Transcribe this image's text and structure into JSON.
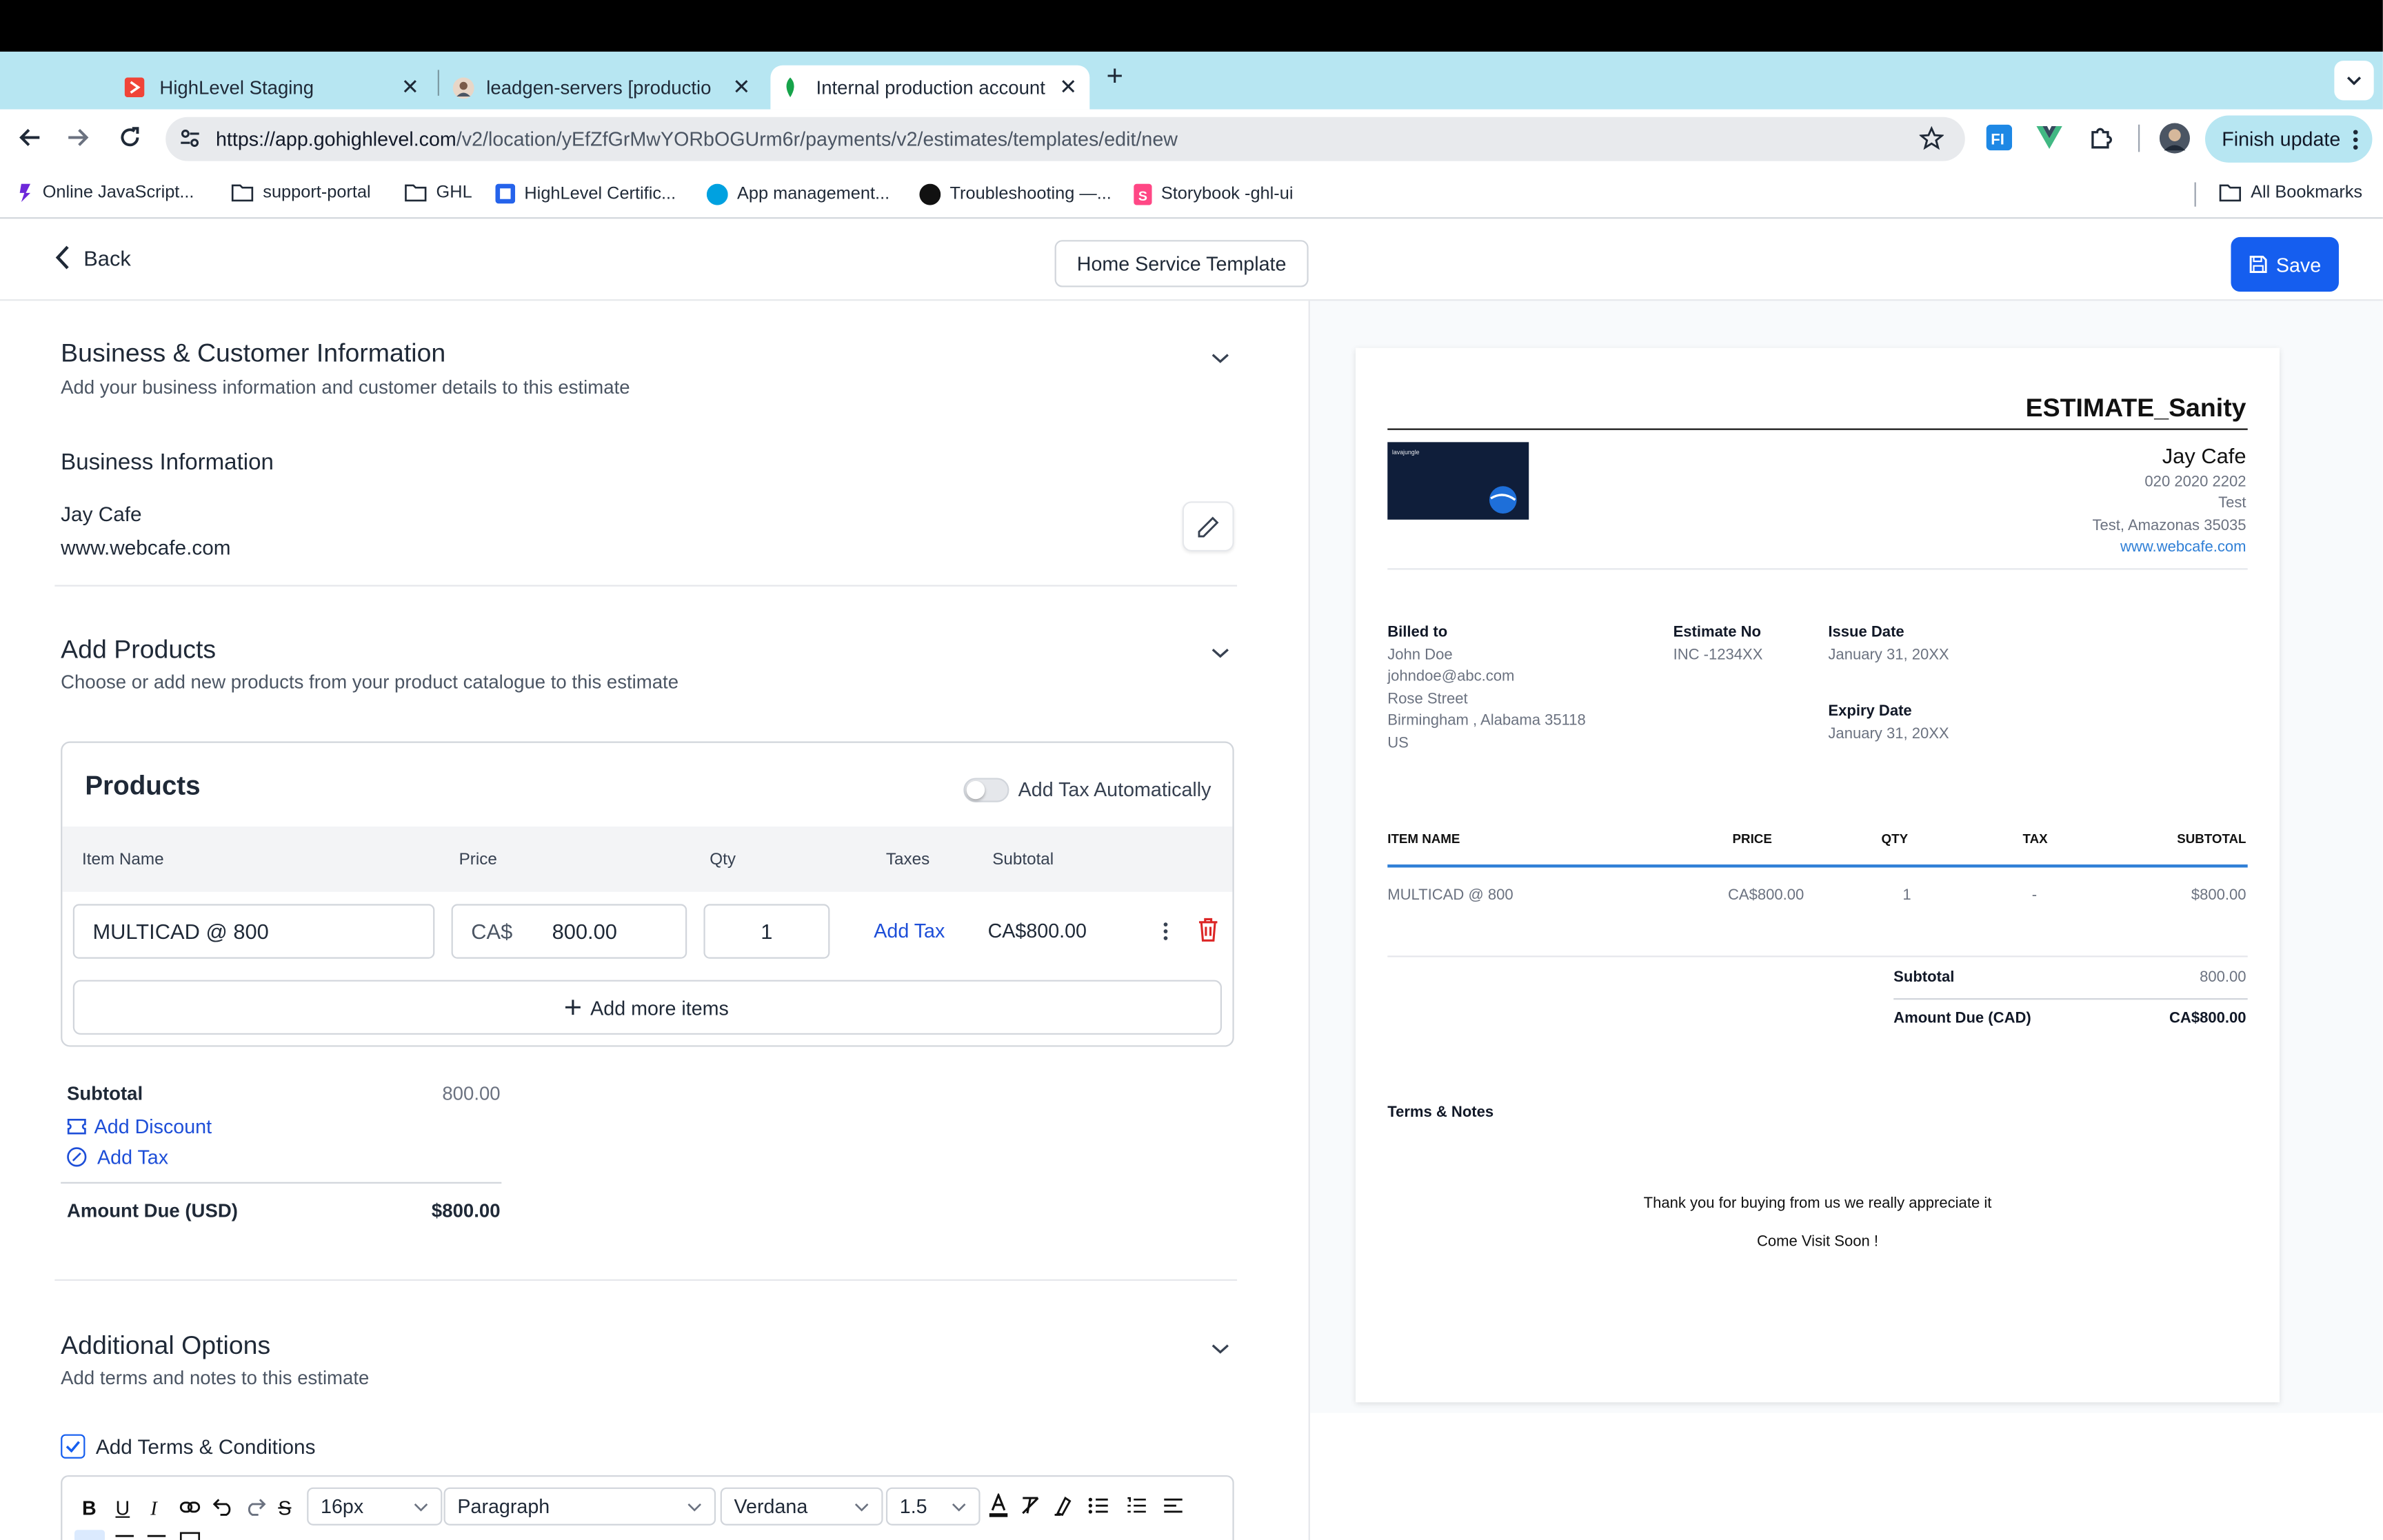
{
  "browser": {
    "tabs": [
      {
        "title": "HighLevel Staging"
      },
      {
        "title": "leadgen-servers [production"
      },
      {
        "title": "Internal production account"
      }
    ],
    "url_host": "https://app.gohighlevel.com",
    "url_path": "/v2/location/yEfZfGrMwYORbOGUrm6r/payments/v2/estimates/templates/edit/new",
    "finish_update_label": "Finish update",
    "bookmarks": [
      "Online JavaScript...",
      "support-portal",
      "GHL",
      "HighLevel Certific...",
      "App management...",
      "Troubleshooting —...",
      "Storybook -ghl-ui"
    ],
    "all_bookmarks_label": "All Bookmarks"
  },
  "header": {
    "back_label": "Back",
    "template_name": "Home Service Template",
    "save_label": "Save"
  },
  "business_section": {
    "title": "Business & Customer Information",
    "subtitle": "Add your business information and customer details to this estimate",
    "business_heading": "Business Information",
    "business_name": "Jay Cafe",
    "business_website": "www.webcafe.com"
  },
  "products_section": {
    "title": "Add Products",
    "subtitle": "Choose or add new products from your product catalogue to this estimate",
    "card_title": "Products",
    "tax_toggle_label": "Add Tax Automatically",
    "tax_toggle_on": false,
    "columns": {
      "item_name": "Item Name",
      "price": "Price",
      "qty": "Qty",
      "taxes": "Taxes",
      "subtotal": "Subtotal"
    },
    "row": {
      "item_name": "MULTICAD @ 800",
      "currency": "CA$",
      "price": "800.00",
      "qty": "1",
      "add_tax_label": "Add Tax",
      "subtotal": "CA$800.00"
    },
    "add_more_label": "Add more items",
    "summary": {
      "subtotal_label": "Subtotal",
      "subtotal_value": "800.00",
      "add_discount_label": "Add Discount",
      "add_tax_label": "Add Tax",
      "amount_due_label": "Amount Due (USD)",
      "amount_due_value": "$800.00"
    }
  },
  "additional_section": {
    "title": "Additional Options",
    "subtitle": "Add terms and notes to this estimate",
    "terms_checkbox_label": "Add Terms & Conditions",
    "terms_checked": true,
    "editor": {
      "font_size": "16px",
      "block": "Paragraph",
      "font": "Verdana",
      "line_height": "1.5"
    }
  },
  "preview": {
    "title": "ESTIMATE_Sanity",
    "logo_text": "lavajungle",
    "business": {
      "name": "Jay Cafe",
      "phone": "020 2020 2202",
      "line1": "Test",
      "line2": "Test, Amazonas 35035",
      "website": "www.webcafe.com"
    },
    "billed_to_label": "Billed to",
    "billed_to": [
      "John Doe",
      "johndoe@abc.com",
      "Rose Street",
      "Birmingham , Alabama 35118",
      "US"
    ],
    "estimate_no_label": "Estimate No",
    "estimate_no": "INC -1234XX",
    "issue_date_label": "Issue Date",
    "issue_date": "January 31, 20XX",
    "expiry_date_label": "Expiry Date",
    "expiry_date": "January 31, 20XX",
    "table_headers": {
      "item_name": "ITEM NAME",
      "price": "PRICE",
      "qty": "QTY",
      "tax": "TAX",
      "subtotal": "SUBTOTAL"
    },
    "row": {
      "item_name": "MULTICAD @ 800",
      "price": "CA$800.00",
      "qty": "1",
      "tax": "-",
      "subtotal": "$800.00"
    },
    "subtotal_label": "Subtotal",
    "subtotal_value": "800.00",
    "amount_due_label": "Amount Due (CAD)",
    "amount_due_value": "CA$800.00",
    "terms_label": "Terms & Notes",
    "note_line1": "Thank you for buying from us we really appreciate it",
    "note_line2": "Come Visit Soon !"
  },
  "colors": {
    "accent": "#155eef",
    "tabstrip": "#b7e6f2",
    "link": "#1d4ed8",
    "danger": "#dc2626"
  }
}
